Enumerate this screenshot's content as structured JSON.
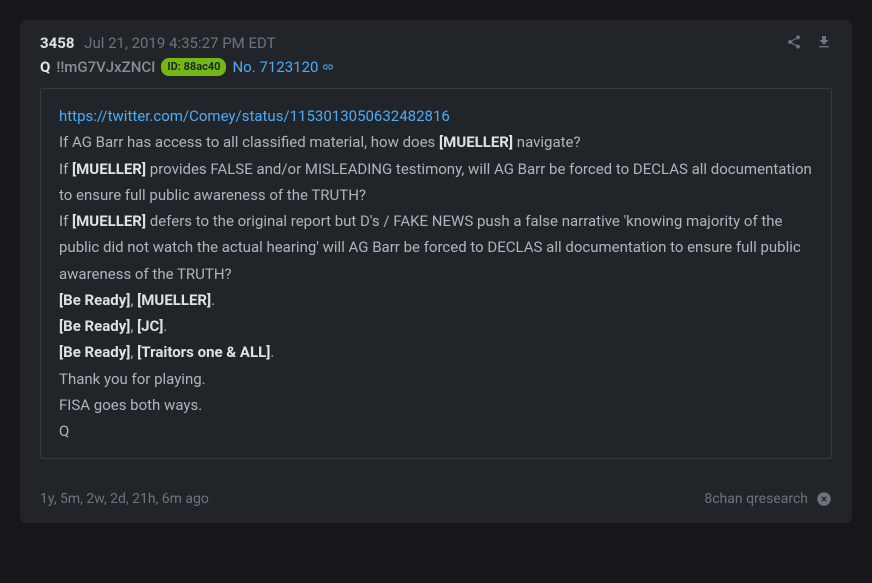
{
  "header": {
    "post_number": "3458",
    "timestamp": "Jul 21, 2019 4:35:27 PM EDT",
    "q_label": "Q",
    "tripcode": "!!mG7VJxZNCI",
    "id_prefix": "ID:",
    "id_val": "88ac40",
    "no_prefix": "No.",
    "no_val": "7123120"
  },
  "body": {
    "link": "https://twitter.com/Comey/status/1153013050632482816",
    "l1a": "If AG Barr has access to all classified material, how does ",
    "l1b": "[MUELLER]",
    "l1c": " navigate?",
    "l2a": "If ",
    "l2b": "[MUELLER]",
    "l2c": " provides FALSE and/or MISLEADING testimony, will AG Barr be forced to DECLAS all documentation to ensure full public awareness of the TRUTH?",
    "l3a": "If ",
    "l3b": "[MUELLER]",
    "l3c": " defers to the original report but D's / FAKE NEWS push a false narrative 'knowing majority of the public did not watch the actual hearing' will AG Barr be forced to DECLAS all documentation to ensure full public awareness of the TRUTH?",
    "l4a": "[Be Ready]",
    "comma": ", ",
    "l4b": "[MUELLER]",
    "period": ".",
    "l5a": "[Be Ready]",
    "l5b": "[JC]",
    "l6a": "[Be Ready]",
    "l6b": "[Traitors one & ALL]",
    "l7": "Thank you for playing.",
    "l8": "FISA goes both ways.",
    "l9": "Q"
  },
  "footer": {
    "ago": "1y, 5m, 2w, 2d, 21h, 6m ago",
    "source": "8chan qresearch"
  }
}
